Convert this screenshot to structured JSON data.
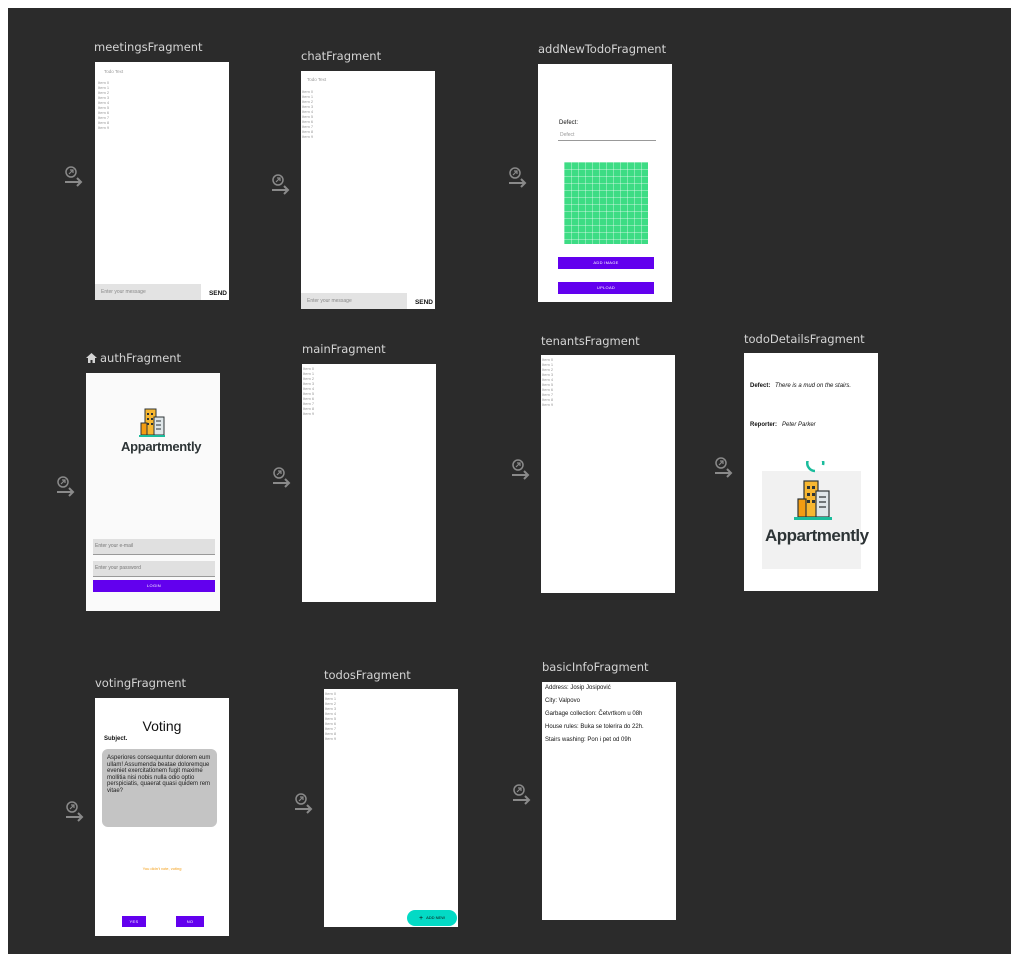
{
  "fragments": {
    "meetings": {
      "title": "meetingsFragment",
      "top_text": "Todo Text",
      "items": [
        "Item 0",
        "Item 1",
        "Item 2",
        "Item 3",
        "Item 4",
        "Item 5",
        "Item 6",
        "Item 7",
        "Item 8",
        "Item 9"
      ],
      "message_placeholder": "Enter your message",
      "send_label": "SEND"
    },
    "chat": {
      "title": "chatFragment",
      "top_text": "Todo Text",
      "items": [
        "Item 0",
        "Item 1",
        "Item 2",
        "Item 3",
        "Item 4",
        "Item 5",
        "Item 6",
        "Item 7",
        "Item 8",
        "Item 9"
      ],
      "message_placeholder": "Enter your message",
      "send_label": "SEND"
    },
    "add_new_todo": {
      "title": "addNewTodoFragment",
      "defect_label": "Defect:",
      "defect_hint": "Defect",
      "add_image_label": "ADD IMAGE",
      "upload_label": "UPLOAD"
    },
    "auth": {
      "title": "authFragment",
      "app_name": "Appartmently",
      "email_hint": "Enter your e-mail",
      "password_hint": "Enter your password",
      "login_label": "LOGIN"
    },
    "main": {
      "title": "mainFragment",
      "items": [
        "Item 0",
        "Item 1",
        "Item 2",
        "Item 3",
        "Item 4",
        "Item 5",
        "Item 6",
        "Item 7",
        "Item 8",
        "Item 9"
      ]
    },
    "tenants": {
      "title": "tenantsFragment",
      "items": [
        "Item 0",
        "Item 1",
        "Item 2",
        "Item 3",
        "Item 4",
        "Item 5",
        "Item 6",
        "Item 7",
        "Item 8",
        "Item 9"
      ]
    },
    "todo_details": {
      "title": "todoDetailsFragment",
      "defect_label": "Defect:",
      "defect_value": "There is a mud on the stairs.",
      "reporter_label": "Reporter:",
      "reporter_value": "Peter Parker",
      "app_name": "Appartmently"
    },
    "voting": {
      "title": "votingFragment",
      "heading": "Voting",
      "subject": "Subject.",
      "body": "Asperiores consequuntur dolorem eum ullam! Assumenda beatae doloremque eveniet exercitationem fugit maxime mollitia nisi nobis nulla odio optio perspiciatis, quaerat quasi quidem rem vitae?",
      "status": "You didn't vote, voting",
      "yes_label": "YES",
      "no_label": "NO"
    },
    "todos": {
      "title": "todosFragment",
      "items": [
        "Item 0",
        "Item 1",
        "Item 2",
        "Item 3",
        "Item 4",
        "Item 5",
        "Item 6",
        "Item 7",
        "Item 8",
        "Item 9"
      ],
      "fab_label": "ADD NEW"
    },
    "basic_info": {
      "title": "basicInfoFragment",
      "lines": [
        "Address: Josip Josipović",
        "City: Valpovo",
        "Garbage collection: Četvrtkom u 08h",
        "House rules: Buka se tolerira do 22h.",
        "Stairs washing: Pon i pet od 09h"
      ]
    }
  },
  "colors": {
    "canvas_bg": "#2b2b2b",
    "primary_button": "#6200ee",
    "fab": "#03dac5",
    "image_placeholder": "#3ddc84"
  },
  "icons": {
    "nav": "deeplink-arrow-icon",
    "start": "home-icon"
  }
}
